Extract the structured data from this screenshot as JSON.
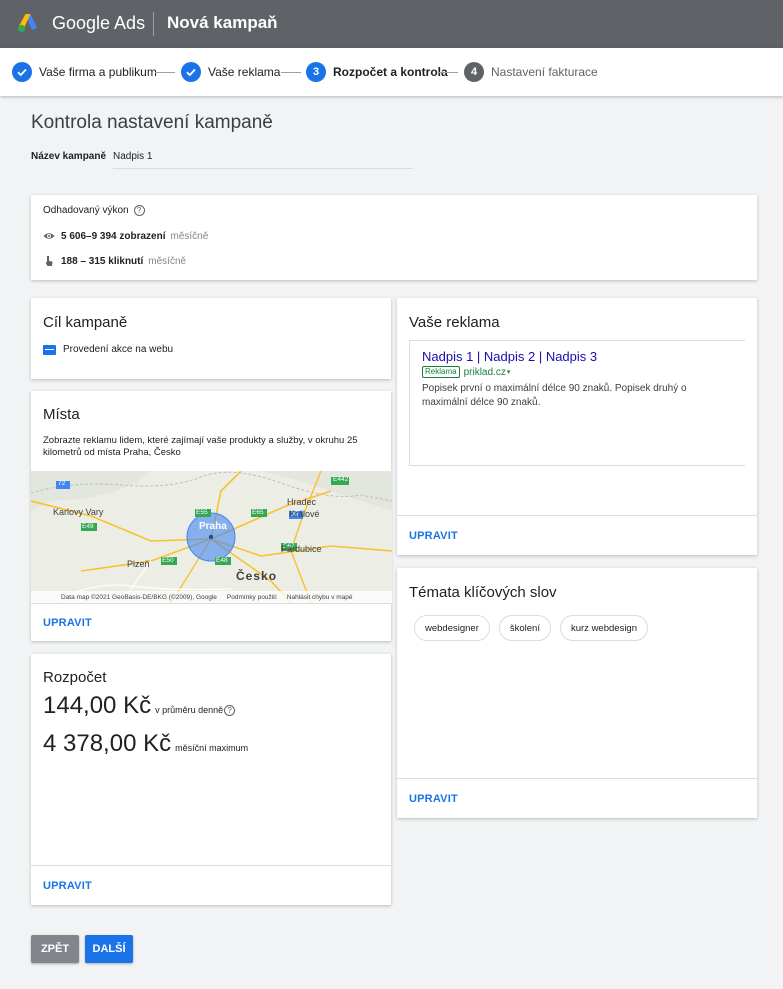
{
  "header": {
    "brand": "Google Ads",
    "page_title": "Nová kampaň"
  },
  "stepper": {
    "steps": [
      {
        "label": "Vaše firma a publikum",
        "state": "done",
        "number": ""
      },
      {
        "label": "Vaše reklama",
        "state": "done",
        "number": ""
      },
      {
        "label": "Rozpočet a kontrola",
        "state": "current",
        "number": "3"
      },
      {
        "label": "Nastavení fakturace",
        "state": "todo",
        "number": "4"
      }
    ]
  },
  "main": {
    "title": "Kontrola nastavení kampaně",
    "campaign_name_label": "Název kampaně",
    "campaign_name_value": "Nadpis 1"
  },
  "performance": {
    "label": "Odhadovaný výkon",
    "impressions_value": "5 606–9 394 zobrazení",
    "impressions_unit": "měsíčně",
    "clicks_value": "188 – 315 kliknutí",
    "clicks_unit": "měsíčně"
  },
  "goal": {
    "title": "Cíl kampaně",
    "value": "Provedení akce na webu"
  },
  "places": {
    "title": "Místa",
    "description": "Zobrazte reklamu lidem, které zajímají vaše produkty a služby, v okruhu 25 kilometrů od místa Praha, Česko",
    "edit": "UPRAVIT",
    "map": {
      "labels": {
        "karlovy_vary": "Karlovy Vary",
        "plzen": "Plzeň",
        "praha": "Praha",
        "hradec": "Hradec",
        "kralove": "Králové",
        "pardubice": "Pardubice",
        "cesko": "Česko"
      },
      "road_labels": [
        "72",
        "E49",
        "E48",
        "E55",
        "E65",
        "E50",
        "E67",
        "93",
        "E442"
      ],
      "attribution": [
        "Data map ©2021 GeoBasis-DE/BKG (©2009), Google",
        "Podmínky použití",
        "Nahlásit chybu v mapě"
      ]
    }
  },
  "budget": {
    "title": "Rozpočet",
    "daily_value": "144,00 Kč",
    "daily_suffix": "v průměru denně",
    "monthly_value": "4 378,00 Kč",
    "monthly_suffix": "měsíční maximum",
    "edit": "UPRAVIT"
  },
  "ad": {
    "title": "Vaše reklama",
    "headline": "Nadpis 1 | Nadpis 2 | Nadpis 3",
    "badge": "Reklama",
    "url": "priklad.cz",
    "description": "Popisek první o maximální délce 90 znaků. Popisek druhý o maximální délce 90 znaků.",
    "edit": "UPRAVIT"
  },
  "keywords": {
    "title": "Témata klíčových slov",
    "chips": [
      "webdesigner",
      "školení",
      "kurz webdesign"
    ],
    "edit": "UPRAVIT"
  },
  "footer": {
    "back_label": "ZPĚT",
    "next_label": "DALŠÍ"
  },
  "colors": {
    "accent": "#1a73e8",
    "header_bg": "#5f6368",
    "ad_headline": "#1a0dab",
    "ad_url": "#188038"
  },
  "icons": {
    "logo": "google-ads-logo",
    "step_done": "check-icon",
    "help": "help-circle-icon",
    "impressions": "eye-icon",
    "clicks": "cursor-click-icon",
    "goal": "web-action-icon"
  }
}
